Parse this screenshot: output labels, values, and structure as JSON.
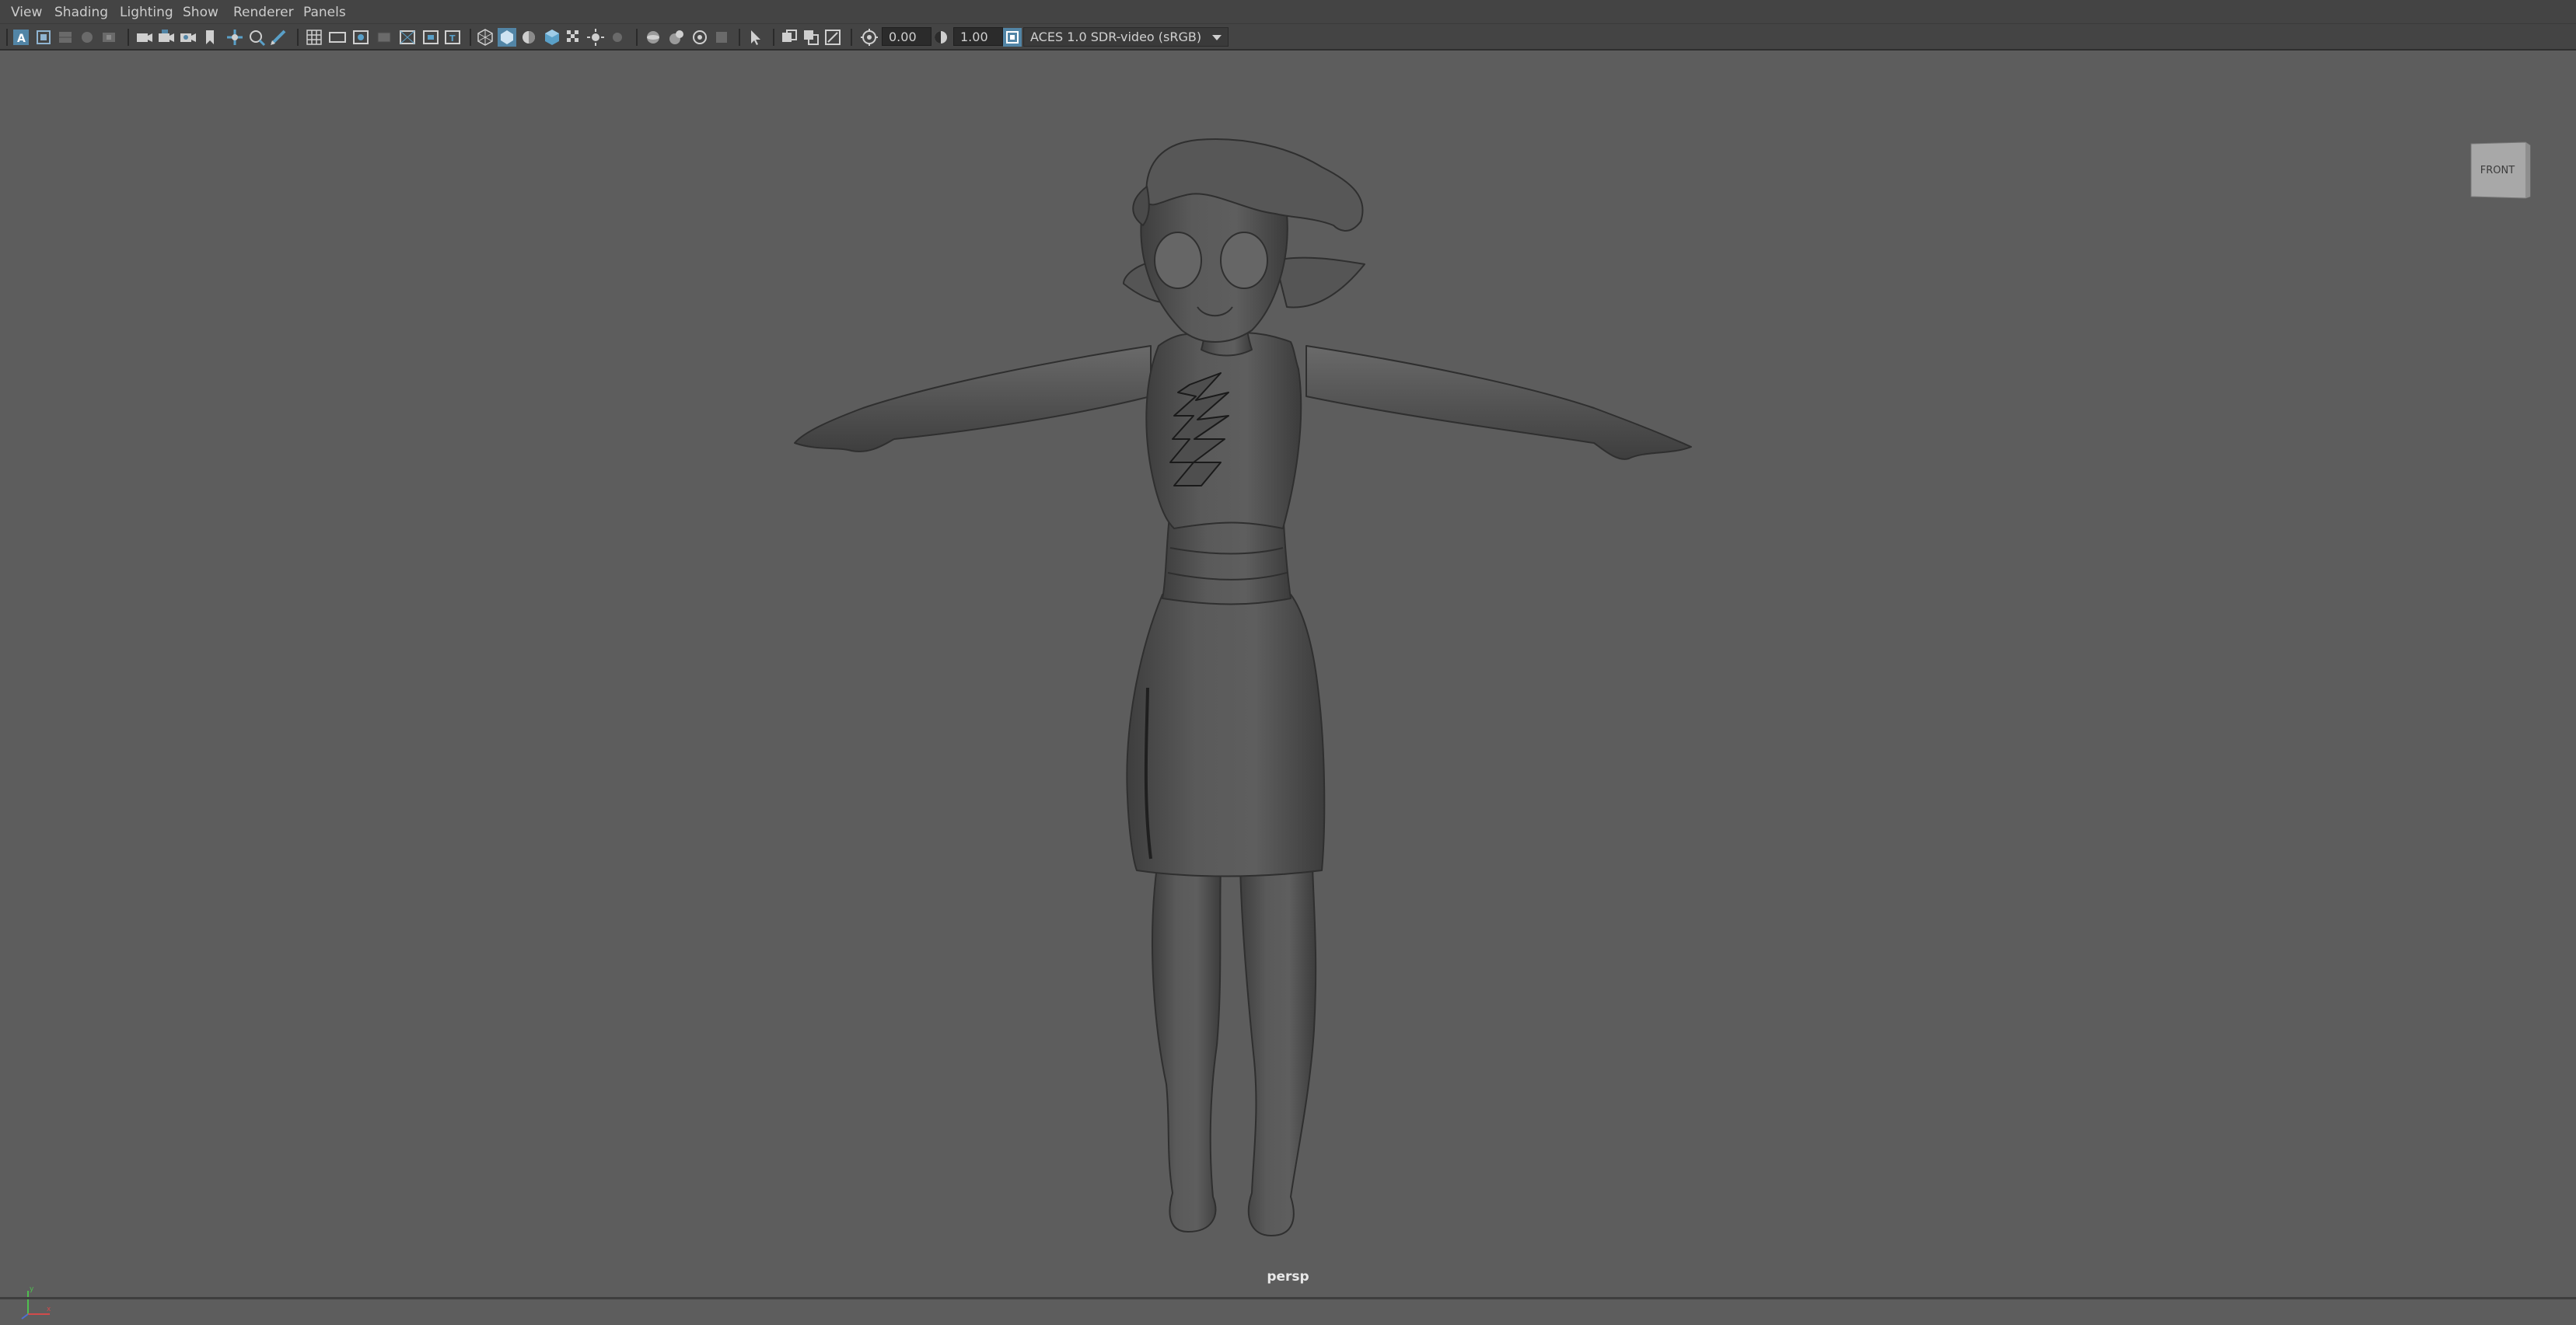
{
  "menubar": {
    "items": [
      {
        "label": "View"
      },
      {
        "label": "Shading"
      },
      {
        "label": "Lighting"
      },
      {
        "label": "Show"
      },
      {
        "label": "Renderer"
      },
      {
        "label": "Panels"
      }
    ]
  },
  "toolbar": {
    "exposure_value": "0.00",
    "gamma_value": "1.00",
    "color_space": "ACES 1.0 SDR-video (sRGB)",
    "icons": [
      "select-camera-icon",
      "camera-attributes-icon",
      "bookmarks-icon",
      "image-plane-icon",
      "2d-pan-zoom-icon",
      "grease-pencil-icon",
      "grid-icon",
      "film-gate-icon",
      "resolution-gate-icon",
      "gate-mask-icon",
      "field-chart-icon",
      "safe-action-icon",
      "safe-title-icon",
      "wireframe-icon",
      "smooth-shade-icon",
      "default-material-icon",
      "textured-icon",
      "use-all-lights-icon",
      "shadows-icon",
      "ambient-occlusion-icon",
      "motion-blur-icon",
      "anti-aliasing-icon",
      "depth-of-field-icon",
      "isolate-select-icon",
      "xray-icon",
      "xray-joints-icon",
      "xray-active-icon",
      "exposure-icon",
      "gamma-icon",
      "color-management-icon"
    ]
  },
  "viewport": {
    "camera_label": "persp",
    "viewcube_face": "FRONT",
    "background_color": "#5d5d5d",
    "model": "character-in-t-pose"
  },
  "colors": {
    "menubar_bg": "#444444",
    "accent_blue": "#5285a6",
    "text": "#cccccc"
  }
}
